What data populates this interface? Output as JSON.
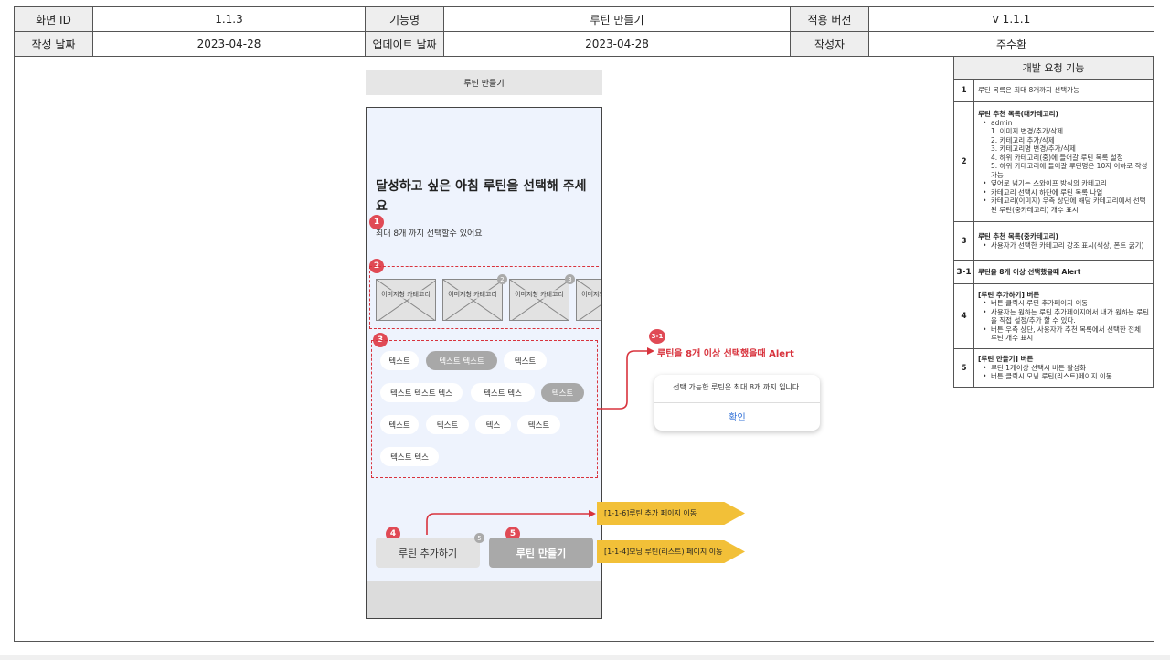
{
  "header": {
    "screen_id_label": "화면 ID",
    "screen_id": "1.1.3",
    "feature_label": "기능명",
    "feature": "루틴 만들기",
    "version_label": "적용 버전",
    "version": "v 1.1.1",
    "created_label": "작성 날짜",
    "created": "2023-04-28",
    "updated_label": "업데이트 날짜",
    "updated": "2023-04-28",
    "author_label": "작성자",
    "author": "주수환"
  },
  "screen": {
    "title": "루틴 만들기",
    "headline": "달성하고 싶은 아침 루틴을 선택해 주세요",
    "subtitle": "최대 8개 까지 선택할수 있어요",
    "category_label": "이미지형 카테고리",
    "category_counts": [
      "2",
      "3"
    ],
    "chips": [
      "텍스트",
      "텍스트 텍스트",
      "텍스트",
      "텍스트 텍스트 텍스",
      "텍스트 텍스",
      "텍스트",
      "텍스트",
      "텍스트",
      "텍스",
      "텍스트",
      "텍스트 텍스"
    ],
    "add_button": "루틴 추가하기",
    "make_button": "루틴 만들기",
    "add_count": "5"
  },
  "markers": [
    "1",
    "2",
    "3",
    "3-1",
    "4",
    "5"
  ],
  "alert": {
    "title": "루틴을 8개 이상 선택했을때 Alert",
    "message": "선택 가능한 루틴은 최대 8개 까지 입니다.",
    "confirm": "확인"
  },
  "tags": [
    "[1-1-6]루틴 추가 페이지 이동",
    "[1-1-4]모닝 루틴(리스트) 페이지 이동"
  ],
  "spec": {
    "title": "개발 요청 기능",
    "rows": [
      {
        "no": "1",
        "heading": "",
        "lines": [
          {
            "t": "루틴 목록은 최대 8개까지 선택가능",
            "b": false
          }
        ]
      },
      {
        "no": "2",
        "heading": "루틴 추천 목록(대카테고리)",
        "lines": [
          {
            "t": "admin",
            "b": true
          },
          {
            "t": "1. 이미지 변경/추가/삭제",
            "b": false
          },
          {
            "t": "2. 카테고리 추가/삭제",
            "b": false
          },
          {
            "t": "3. 카테고리명 변경/추가/삭제",
            "b": false
          },
          {
            "t": "4. 하위 카테고리(중)에 들어갈 루틴 목록 설정",
            "b": false
          },
          {
            "t": "5. 하위 카테고리에 들어갈 루틴명은 10자 이하로 작성 가능",
            "b": false
          },
          {
            "t": "옆어로 넘기는 스와이프 방식의 카테고리",
            "b": true
          },
          {
            "t": "카테고리 선택시 하단에 루틴 목록 나열",
            "b": true
          },
          {
            "t": "카테고리(이미지) 우측 상단에 해당 카테고리에서 선택된 루틴(중카테고리) 개수 표시",
            "b": true
          }
        ]
      },
      {
        "no": "3",
        "heading": "루틴 추천 목록(중카테고리)",
        "lines": [
          {
            "t": "사용자가 선택한 카테고리 강조 표시(색상, 폰트 굵기)",
            "b": true
          }
        ]
      },
      {
        "no": "3-1",
        "heading": "루틴을 8개 이상 선택했을때 Alert",
        "lines": []
      },
      {
        "no": "4",
        "heading": "[루틴 추가하기] 버튼",
        "lines": [
          {
            "t": "버튼 클릭시 루틴 추가페이지 이동",
            "b": true
          },
          {
            "t": "사용자는 원하는 루틴 추가페이지에서 내가 원하는 루틴을 직접 설정/추가 할 수 있다.",
            "b": true
          },
          {
            "t": "버튼 우측 상단, 사용자가 추천 목록에서 선택한 전체 루틴 개수 표시",
            "b": true
          }
        ]
      },
      {
        "no": "5",
        "heading": "[루틴 만들기] 버튼",
        "lines": [
          {
            "t": "루틴 1개이상 선택시 버튼 활성화",
            "b": true
          },
          {
            "t": "버튼 클릭시 모닝 루틴(리스트)페이지 이동",
            "b": true
          }
        ]
      }
    ]
  }
}
